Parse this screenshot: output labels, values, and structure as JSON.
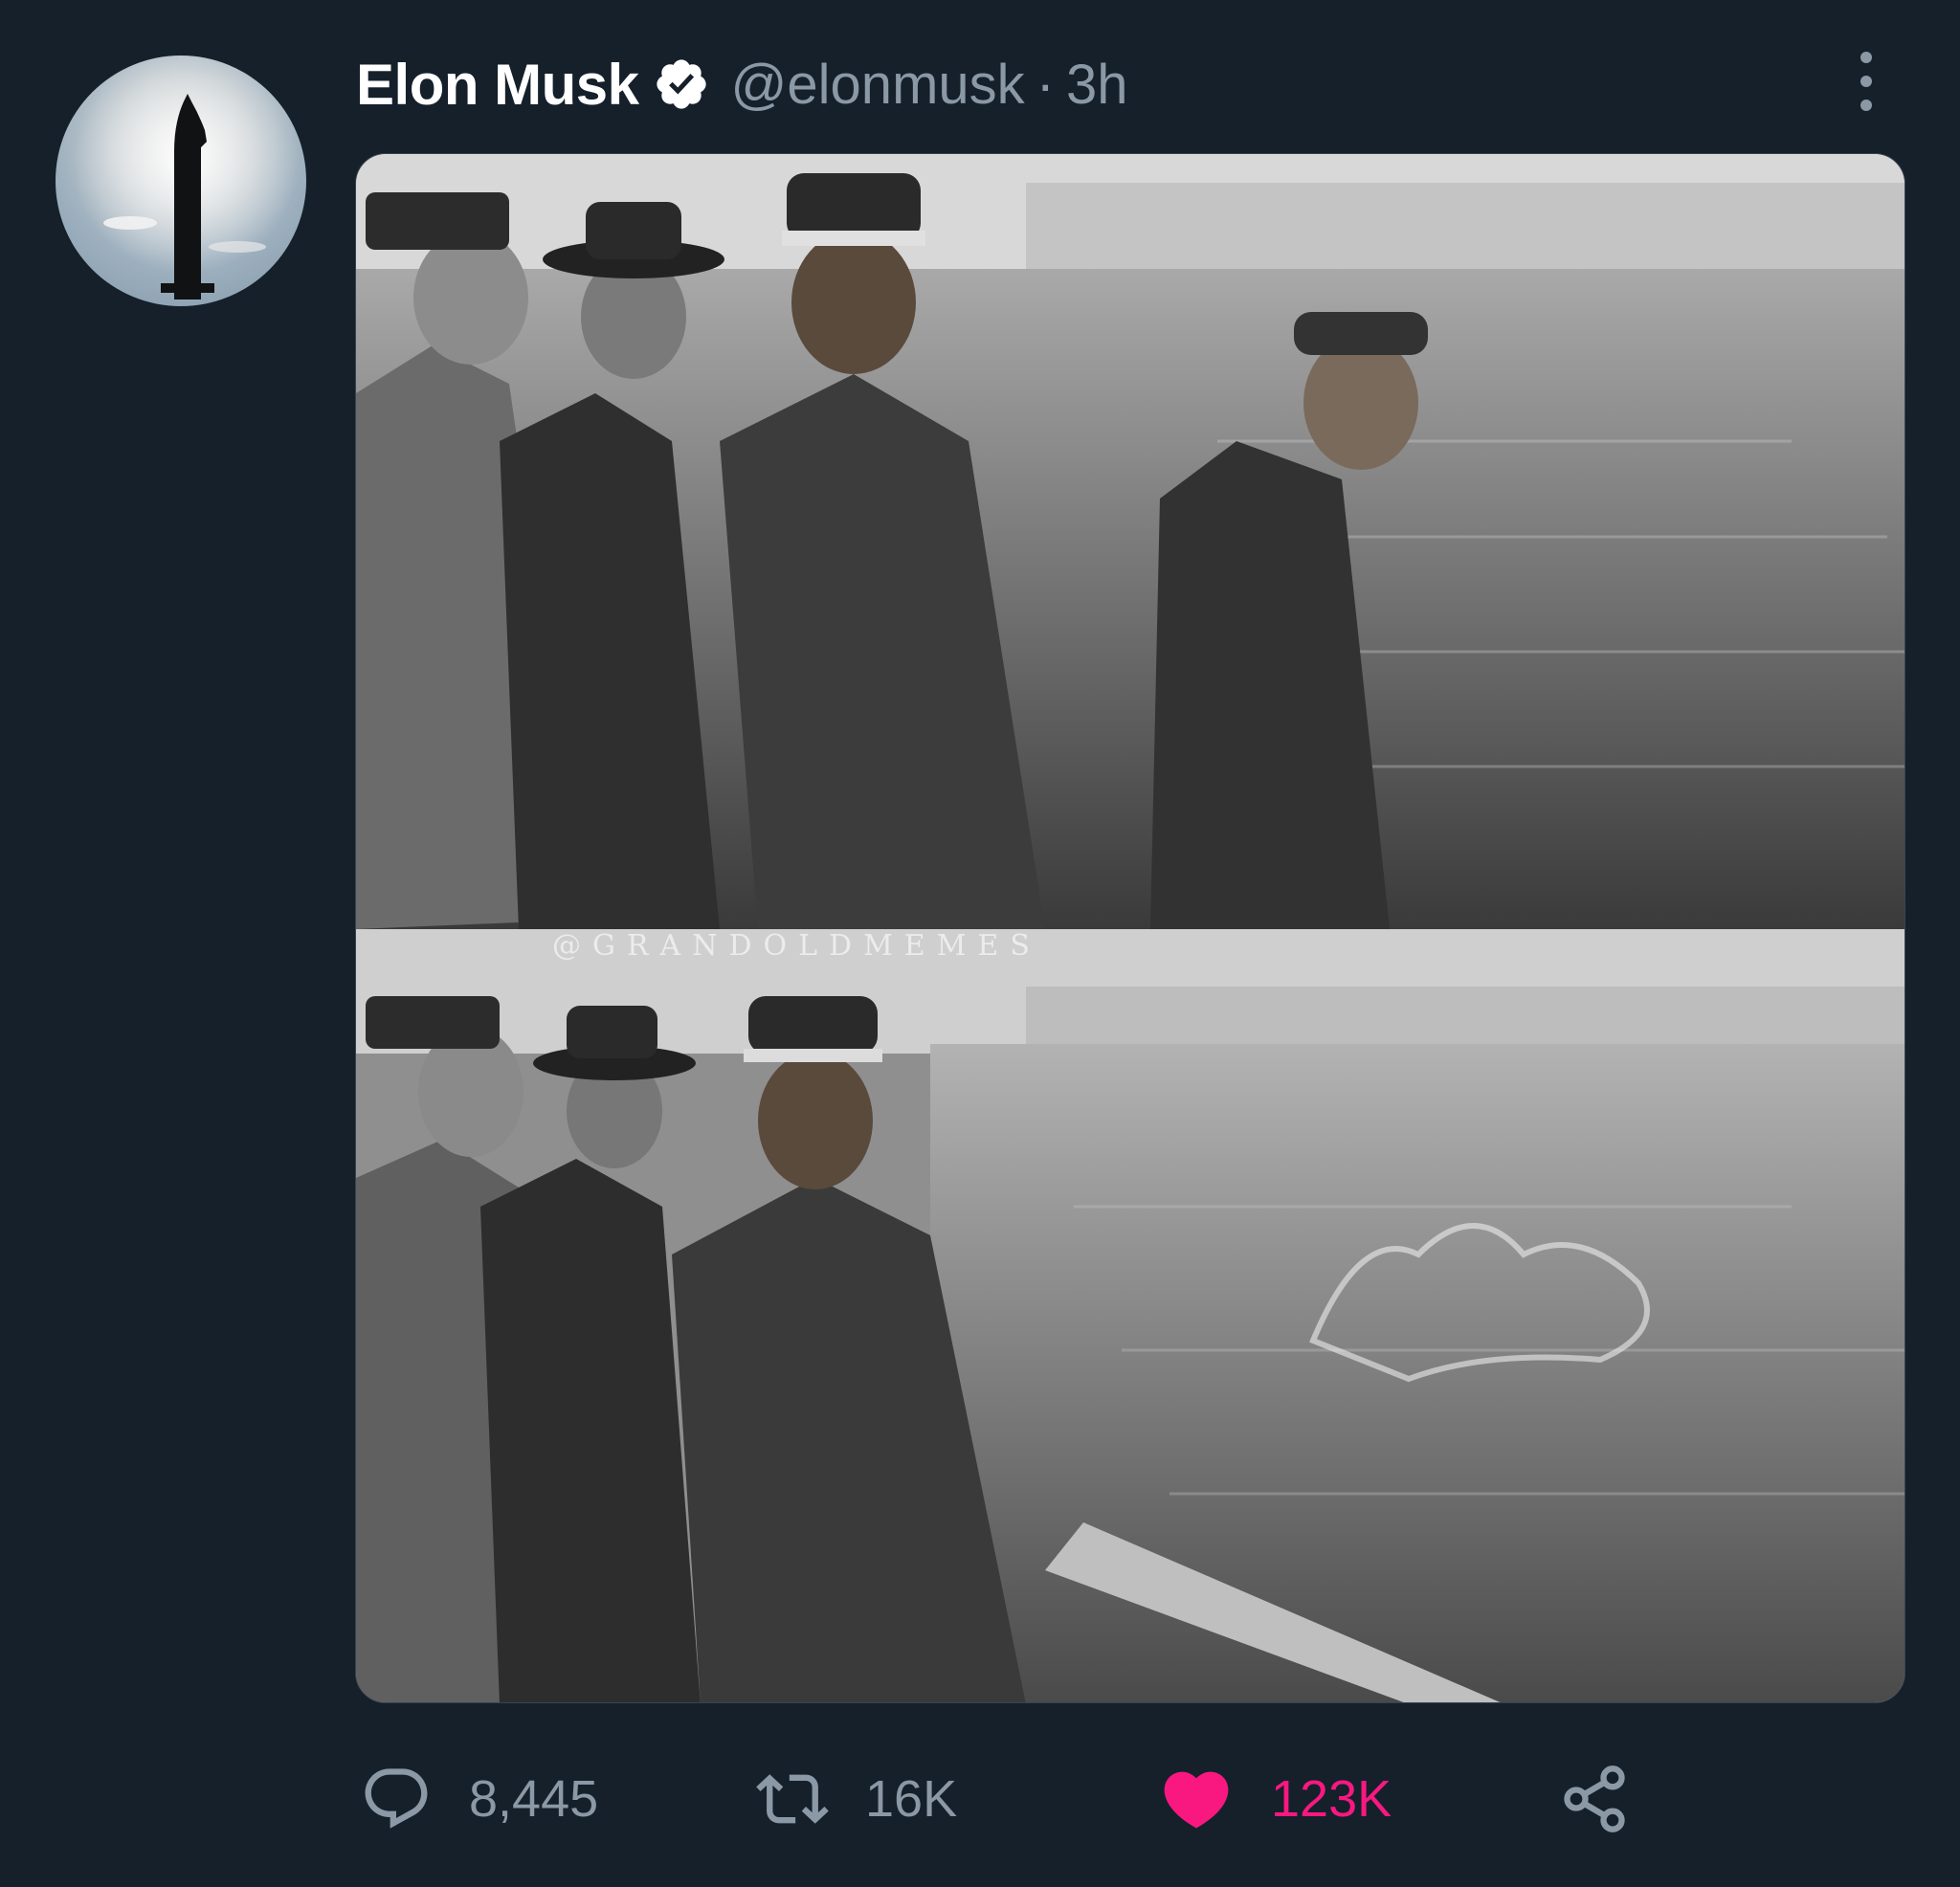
{
  "tweet": {
    "author_name": "Elon Musk",
    "handle": "@elonmusk",
    "separator": "·",
    "time": "3h",
    "verified": true,
    "avatar_icon": "starship-avatar",
    "media": {
      "watermark": "@GRANDOLDMEMES"
    }
  },
  "actions": {
    "reply": {
      "icon": "reply-icon",
      "count": "8,445"
    },
    "retweet": {
      "icon": "retweet-icon",
      "count": "16K"
    },
    "like": {
      "icon": "heart-filled-icon",
      "count": "123K",
      "color": "#f91880"
    },
    "share": {
      "icon": "share-icon"
    }
  },
  "colors": {
    "background": "#15202b",
    "secondary_text": "#8b98a5",
    "verified_badge": "#ffffff"
  }
}
